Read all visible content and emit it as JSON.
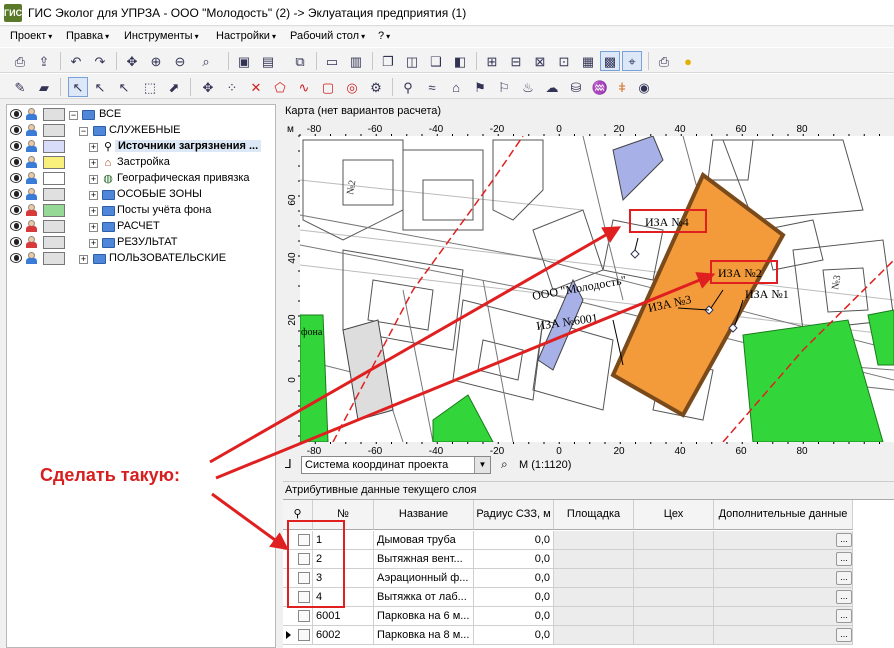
{
  "window": {
    "title": "ГИС Эколог для УПРЗА - ООО \"Молодость\" (2) -> Эклуатация предприятия (1)",
    "app_icon": "ГИС"
  },
  "menu": [
    {
      "label": "Проект",
      "arrow": "▾"
    },
    {
      "label": "Правка",
      "arrow": "▾"
    },
    {
      "label": "Инструменты",
      "arrow": "▾"
    },
    {
      "label": "Настройки",
      "arrow": "▾"
    },
    {
      "label": "Рабочий стол",
      "arrow": "▾"
    },
    {
      "label": "?",
      "arrow": "▾"
    }
  ],
  "toolbar1_icons": [
    "print-icon",
    "export-icon",
    "undo-icon",
    "redo-icon",
    "zoom-in-icon",
    "zoom-out-icon",
    "zoom-select-icon",
    "add-layer-icon",
    "layer-props-icon",
    "layer-copy-icon",
    "layer-a-icon",
    "layer-b-icon",
    "window-a-icon",
    "window-b-icon",
    "window-c-icon",
    "window-d-icon",
    "table-add-icon",
    "table-icon",
    "table-a-icon",
    "table-b-icon",
    "table-c-icon",
    "table-d-icon",
    "table-e-icon",
    "grid-select-icon",
    "grid-edit-icon",
    "printer-icon",
    "lightbulb-icon"
  ],
  "toolbar2_icons": [
    "pencil-icon",
    "eraser-icon",
    "pointer-icon",
    "pointer-alt-icon",
    "select-node-icon",
    "select-move-icon",
    "move-icon",
    "node-icon",
    "delete-icon",
    "polygon-icon",
    "line-icon",
    "rect-icon",
    "circle-icon",
    "gear-icon",
    "point-source-icon",
    "line-source-icon",
    "area-source-icon",
    "source-a-icon",
    "source-b-icon",
    "source-c-icon",
    "source-d-icon",
    "source-e-icon",
    "pin-icon",
    "measure-icon"
  ],
  "tree": {
    "items": [
      {
        "label": "ВСЕ",
        "swatch": "#e0e0e0"
      },
      {
        "label": "СЛУЖЕБНЫЕ",
        "swatch": "#e0e0e0"
      },
      {
        "label": "Источники загрязнения ...",
        "swatch": "#d8dcf8"
      },
      {
        "label": "Застройка",
        "swatch": "#f8f07a"
      },
      {
        "label": "Географическая привязка",
        "swatch": "#ffffff"
      },
      {
        "label": "ОСОБЫЕ ЗОНЫ",
        "swatch": "#e0e0e0"
      },
      {
        "label": "Посты учёта фона",
        "swatch": "#96d896"
      },
      {
        "label": "РАСЧЕТ",
        "swatch": "#e0e0e0"
      },
      {
        "label": "РЕЗУЛЬТАТ",
        "swatch": "#e0e0e0"
      },
      {
        "label": "ПОЛЬЗОВАТЕЛЬСКИЕ",
        "swatch": "#e0e0e0"
      }
    ]
  },
  "map": {
    "panel_title": "Карта (нет вариантов расчета)",
    "corner_label": "м",
    "x_ticks": [
      "-80",
      "-60",
      "-40",
      "-20",
      "0",
      "20",
      "40",
      "60",
      "80"
    ],
    "y_ticks": [
      "60",
      "40",
      "20",
      "0"
    ],
    "labels": {
      "iza4": "ИЗА №4",
      "iza2": "ИЗА №2",
      "iza1": "ИЗА №1",
      "iza3": "ИЗА №3",
      "iza6001": "ИЗА №6001",
      "org": "ООО \"Молодость\"",
      "no2": "№2",
      "no3": "№3",
      "fona": "фона"
    },
    "colors": {
      "orange": "#f39a3a",
      "orange_border": "#7a4a1a",
      "green": "#33d63a",
      "blue": "#a8b0e8",
      "red": "#e02020"
    }
  },
  "coordbar": {
    "system": "Система координат проекта",
    "scale": "М (1:1120)"
  },
  "attr": {
    "panel_title": "Атрибутивные данные текущего слоя",
    "columns": [
      "№",
      "Название",
      "Радиус СЗЗ, м",
      "Площадка",
      "Цех",
      "Дополнительные данные"
    ],
    "rows": [
      {
        "no": "1",
        "name": "Дымовая труба",
        "radius": "0,0"
      },
      {
        "no": "2",
        "name": "Вытяжная вент...",
        "radius": "0,0"
      },
      {
        "no": "3",
        "name": "Аэрационный ф...",
        "radius": "0,0"
      },
      {
        "no": "4",
        "name": "Вытяжка от лаб...",
        "radius": "0,0"
      },
      {
        "no": "6001",
        "name": "Парковка на 6 м...",
        "radius": "0,0"
      },
      {
        "no": "6002",
        "name": "Парковка на 8 м...",
        "radius": "0,0"
      }
    ],
    "ellipsis": "..."
  },
  "annotation": {
    "text": "Сделать такую:",
    "color": "#d62020"
  }
}
